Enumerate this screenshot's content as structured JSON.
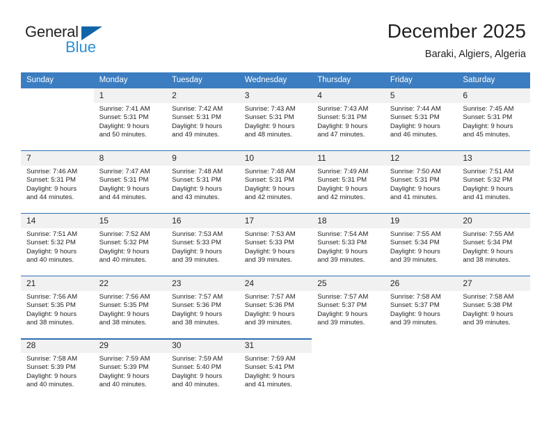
{
  "brand": {
    "name_part1": "General",
    "name_part2": "Blue",
    "triangle_color": "#1264a8",
    "blue_text_color": "#2b8fd4"
  },
  "header": {
    "title": "December 2025",
    "subtitle": "Baraki, Algiers, Algeria"
  },
  "theme": {
    "header_band": "#3b7dc0",
    "week_divider": "#2c6fb5",
    "date_band": "#f1f1f1",
    "text": "#231f20"
  },
  "weekdays": [
    "Sunday",
    "Monday",
    "Tuesday",
    "Wednesday",
    "Thursday",
    "Friday",
    "Saturday"
  ],
  "weeks": [
    {
      "days": [
        {
          "date": "",
          "sunrise": "",
          "sunset": "",
          "daylight_line1": "",
          "daylight_line2": ""
        },
        {
          "date": "1",
          "sunrise": "Sunrise: 7:41 AM",
          "sunset": "Sunset: 5:31 PM",
          "daylight_line1": "Daylight: 9 hours",
          "daylight_line2": "and 50 minutes."
        },
        {
          "date": "2",
          "sunrise": "Sunrise: 7:42 AM",
          "sunset": "Sunset: 5:31 PM",
          "daylight_line1": "Daylight: 9 hours",
          "daylight_line2": "and 49 minutes."
        },
        {
          "date": "3",
          "sunrise": "Sunrise: 7:43 AM",
          "sunset": "Sunset: 5:31 PM",
          "daylight_line1": "Daylight: 9 hours",
          "daylight_line2": "and 48 minutes."
        },
        {
          "date": "4",
          "sunrise": "Sunrise: 7:43 AM",
          "sunset": "Sunset: 5:31 PM",
          "daylight_line1": "Daylight: 9 hours",
          "daylight_line2": "and 47 minutes."
        },
        {
          "date": "5",
          "sunrise": "Sunrise: 7:44 AM",
          "sunset": "Sunset: 5:31 PM",
          "daylight_line1": "Daylight: 9 hours",
          "daylight_line2": "and 46 minutes."
        },
        {
          "date": "6",
          "sunrise": "Sunrise: 7:45 AM",
          "sunset": "Sunset: 5:31 PM",
          "daylight_line1": "Daylight: 9 hours",
          "daylight_line2": "and 45 minutes."
        }
      ]
    },
    {
      "days": [
        {
          "date": "7",
          "sunrise": "Sunrise: 7:46 AM",
          "sunset": "Sunset: 5:31 PM",
          "daylight_line1": "Daylight: 9 hours",
          "daylight_line2": "and 44 minutes."
        },
        {
          "date": "8",
          "sunrise": "Sunrise: 7:47 AM",
          "sunset": "Sunset: 5:31 PM",
          "daylight_line1": "Daylight: 9 hours",
          "daylight_line2": "and 44 minutes."
        },
        {
          "date": "9",
          "sunrise": "Sunrise: 7:48 AM",
          "sunset": "Sunset: 5:31 PM",
          "daylight_line1": "Daylight: 9 hours",
          "daylight_line2": "and 43 minutes."
        },
        {
          "date": "10",
          "sunrise": "Sunrise: 7:48 AM",
          "sunset": "Sunset: 5:31 PM",
          "daylight_line1": "Daylight: 9 hours",
          "daylight_line2": "and 42 minutes."
        },
        {
          "date": "11",
          "sunrise": "Sunrise: 7:49 AM",
          "sunset": "Sunset: 5:31 PM",
          "daylight_line1": "Daylight: 9 hours",
          "daylight_line2": "and 42 minutes."
        },
        {
          "date": "12",
          "sunrise": "Sunrise: 7:50 AM",
          "sunset": "Sunset: 5:31 PM",
          "daylight_line1": "Daylight: 9 hours",
          "daylight_line2": "and 41 minutes."
        },
        {
          "date": "13",
          "sunrise": "Sunrise: 7:51 AM",
          "sunset": "Sunset: 5:32 PM",
          "daylight_line1": "Daylight: 9 hours",
          "daylight_line2": "and 41 minutes."
        }
      ]
    },
    {
      "days": [
        {
          "date": "14",
          "sunrise": "Sunrise: 7:51 AM",
          "sunset": "Sunset: 5:32 PM",
          "daylight_line1": "Daylight: 9 hours",
          "daylight_line2": "and 40 minutes."
        },
        {
          "date": "15",
          "sunrise": "Sunrise: 7:52 AM",
          "sunset": "Sunset: 5:32 PM",
          "daylight_line1": "Daylight: 9 hours",
          "daylight_line2": "and 40 minutes."
        },
        {
          "date": "16",
          "sunrise": "Sunrise: 7:53 AM",
          "sunset": "Sunset: 5:33 PM",
          "daylight_line1": "Daylight: 9 hours",
          "daylight_line2": "and 39 minutes."
        },
        {
          "date": "17",
          "sunrise": "Sunrise: 7:53 AM",
          "sunset": "Sunset: 5:33 PM",
          "daylight_line1": "Daylight: 9 hours",
          "daylight_line2": "and 39 minutes."
        },
        {
          "date": "18",
          "sunrise": "Sunrise: 7:54 AM",
          "sunset": "Sunset: 5:33 PM",
          "daylight_line1": "Daylight: 9 hours",
          "daylight_line2": "and 39 minutes."
        },
        {
          "date": "19",
          "sunrise": "Sunrise: 7:55 AM",
          "sunset": "Sunset: 5:34 PM",
          "daylight_line1": "Daylight: 9 hours",
          "daylight_line2": "and 39 minutes."
        },
        {
          "date": "20",
          "sunrise": "Sunrise: 7:55 AM",
          "sunset": "Sunset: 5:34 PM",
          "daylight_line1": "Daylight: 9 hours",
          "daylight_line2": "and 38 minutes."
        }
      ]
    },
    {
      "days": [
        {
          "date": "21",
          "sunrise": "Sunrise: 7:56 AM",
          "sunset": "Sunset: 5:35 PM",
          "daylight_line1": "Daylight: 9 hours",
          "daylight_line2": "and 38 minutes."
        },
        {
          "date": "22",
          "sunrise": "Sunrise: 7:56 AM",
          "sunset": "Sunset: 5:35 PM",
          "daylight_line1": "Daylight: 9 hours",
          "daylight_line2": "and 38 minutes."
        },
        {
          "date": "23",
          "sunrise": "Sunrise: 7:57 AM",
          "sunset": "Sunset: 5:36 PM",
          "daylight_line1": "Daylight: 9 hours",
          "daylight_line2": "and 38 minutes."
        },
        {
          "date": "24",
          "sunrise": "Sunrise: 7:57 AM",
          "sunset": "Sunset: 5:36 PM",
          "daylight_line1": "Daylight: 9 hours",
          "daylight_line2": "and 39 minutes."
        },
        {
          "date": "25",
          "sunrise": "Sunrise: 7:57 AM",
          "sunset": "Sunset: 5:37 PM",
          "daylight_line1": "Daylight: 9 hours",
          "daylight_line2": "and 39 minutes."
        },
        {
          "date": "26",
          "sunrise": "Sunrise: 7:58 AM",
          "sunset": "Sunset: 5:37 PM",
          "daylight_line1": "Daylight: 9 hours",
          "daylight_line2": "and 39 minutes."
        },
        {
          "date": "27",
          "sunrise": "Sunrise: 7:58 AM",
          "sunset": "Sunset: 5:38 PM",
          "daylight_line1": "Daylight: 9 hours",
          "daylight_line2": "and 39 minutes."
        }
      ]
    },
    {
      "days": [
        {
          "date": "28",
          "sunrise": "Sunrise: 7:58 AM",
          "sunset": "Sunset: 5:39 PM",
          "daylight_line1": "Daylight: 9 hours",
          "daylight_line2": "and 40 minutes."
        },
        {
          "date": "29",
          "sunrise": "Sunrise: 7:59 AM",
          "sunset": "Sunset: 5:39 PM",
          "daylight_line1": "Daylight: 9 hours",
          "daylight_line2": "and 40 minutes."
        },
        {
          "date": "30",
          "sunrise": "Sunrise: 7:59 AM",
          "sunset": "Sunset: 5:40 PM",
          "daylight_line1": "Daylight: 9 hours",
          "daylight_line2": "and 40 minutes."
        },
        {
          "date": "31",
          "sunrise": "Sunrise: 7:59 AM",
          "sunset": "Sunset: 5:41 PM",
          "daylight_line1": "Daylight: 9 hours",
          "daylight_line2": "and 41 minutes."
        },
        {
          "date": "",
          "sunrise": "",
          "sunset": "",
          "daylight_line1": "",
          "daylight_line2": ""
        },
        {
          "date": "",
          "sunrise": "",
          "sunset": "",
          "daylight_line1": "",
          "daylight_line2": ""
        },
        {
          "date": "",
          "sunrise": "",
          "sunset": "",
          "daylight_line1": "",
          "daylight_line2": ""
        }
      ]
    }
  ]
}
